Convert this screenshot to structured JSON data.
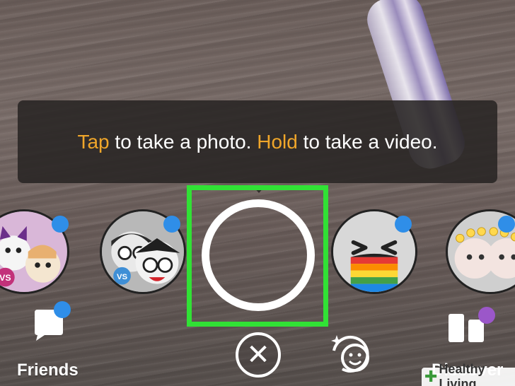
{
  "tooltip": {
    "tap_word": "Tap",
    "tap_rest": " to take a photo. ",
    "hold_word": "Hold",
    "hold_rest": " to take a video."
  },
  "lenses": [
    {
      "name": "lens-cats-vs",
      "badge": "VS"
    },
    {
      "name": "lens-friends-vs",
      "badge": "VS"
    },
    {
      "name": "lens-rainbow-face",
      "badge": ""
    },
    {
      "name": "lens-flower-crown",
      "badge": ""
    }
  ],
  "nav": {
    "friends_label": "Friends",
    "discover_label": "Discover"
  },
  "watermark": {
    "text": "Healthy Living"
  },
  "colors": {
    "accent": "#f0a62a",
    "highlight": "#31e135",
    "notification": "#2f8ee8",
    "discover_dot": "#9b57c9"
  }
}
